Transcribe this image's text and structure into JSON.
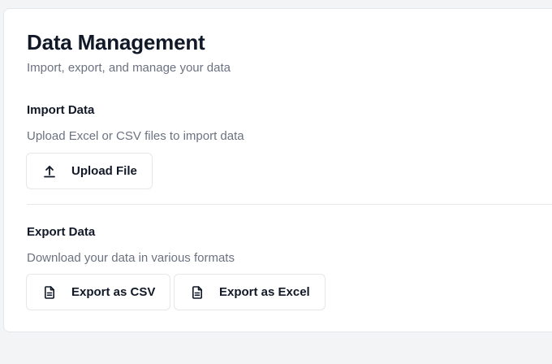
{
  "header": {
    "title": "Data Management",
    "subtitle": "Import, export, and manage your data"
  },
  "import_section": {
    "title": "Import Data",
    "description": "Upload Excel or CSV files to import data",
    "upload_button": {
      "label": "Upload File",
      "icon": "upload-icon"
    }
  },
  "export_section": {
    "title": "Export Data",
    "description": "Download your data in various formats",
    "csv_button": {
      "label": "Export as CSV",
      "icon": "file-icon"
    },
    "excel_button": {
      "label": "Export as Excel",
      "icon": "file-icon"
    }
  },
  "colors": {
    "background": "#f3f4f6",
    "card": "#ffffff",
    "border": "#e5e7eb",
    "heading": "#111827",
    "muted": "#6b7280"
  }
}
